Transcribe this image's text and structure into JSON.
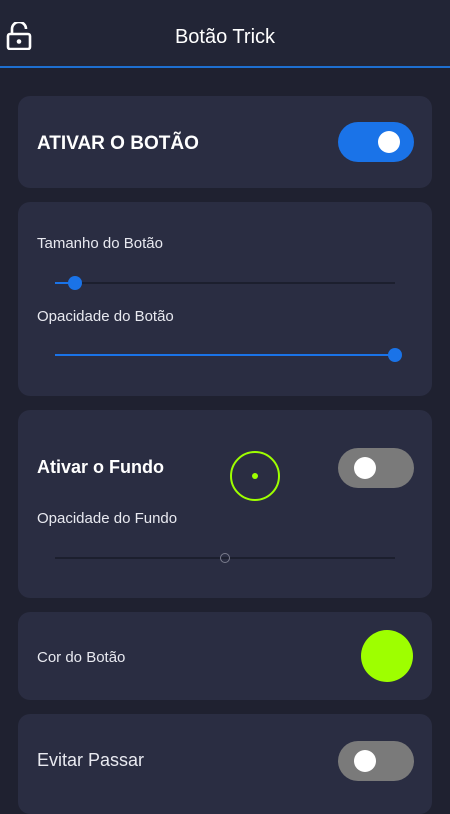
{
  "header": {
    "title": "Botão Trick",
    "icon": "unlock-icon"
  },
  "button_section": {
    "label": "ATIVAR O BOTÃO",
    "enabled": true
  },
  "sliders_section": {
    "size_label": "Tamanho do Botão",
    "size_value": 0.06,
    "opacity_label": "Opacidade do Botão",
    "opacity_value": 1.0
  },
  "background_section": {
    "label": "Ativar o Fundo",
    "enabled": false,
    "opacity_label": "Opacidade do Fundo",
    "opacity_value": 0.5,
    "preview_icon": "target-icon"
  },
  "color_section": {
    "label": "Cor do Botão",
    "color": "#9eff00"
  },
  "avoid_section": {
    "label": "Evitar Passar",
    "enabled": false
  },
  "colors": {
    "accent": "#1a73e8",
    "button_color": "#9eff00"
  }
}
